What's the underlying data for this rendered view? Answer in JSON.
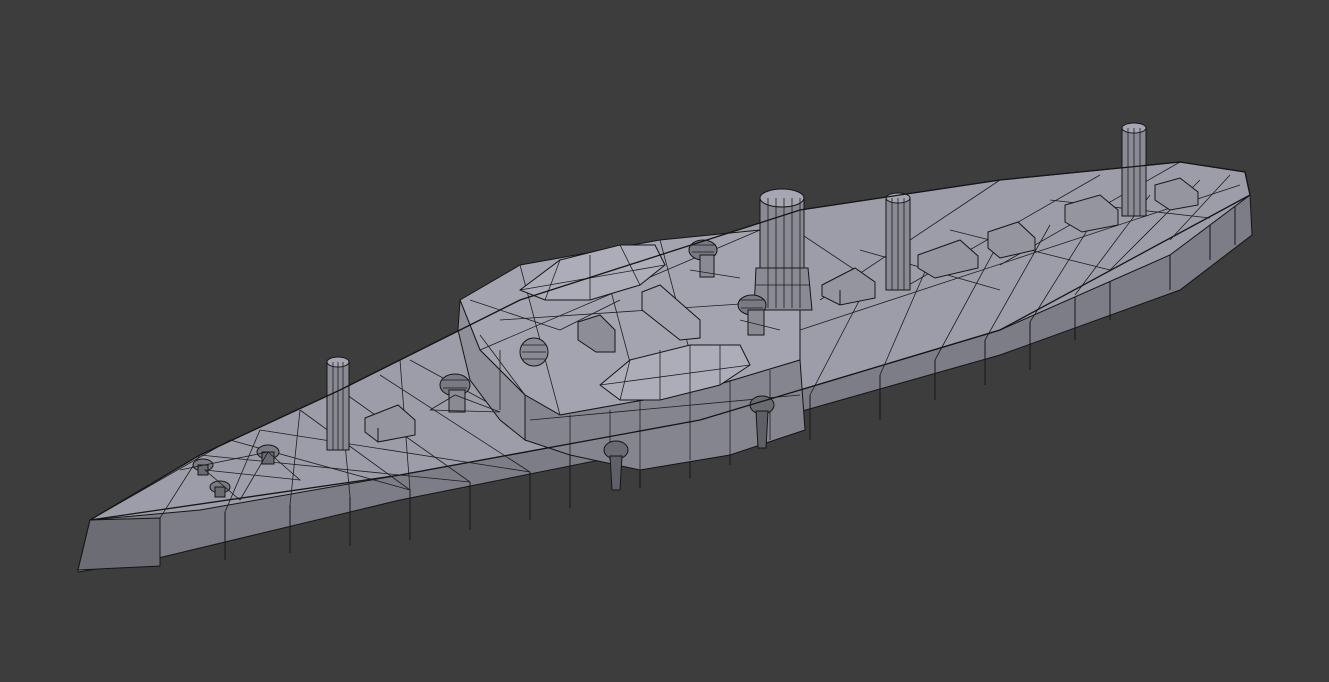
{
  "viewport": {
    "background_color": "#3d3d3d",
    "shading": {
      "deck_color": "#9c9ca8",
      "deck_light_color": "#a8a8b4",
      "hull_side_color": "#7e7e88",
      "hull_side_dark_color": "#6a6a73",
      "wire_color": "#151515"
    }
  }
}
